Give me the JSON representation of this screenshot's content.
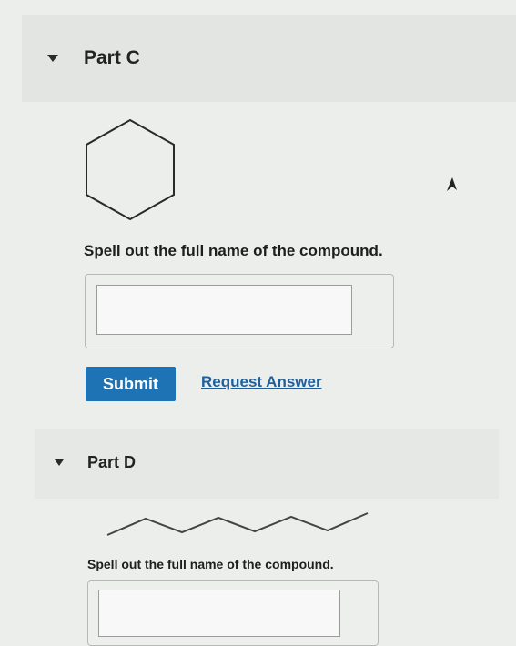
{
  "part_c": {
    "title": "Part C",
    "prompt": "Spell out the full name of the compound.",
    "answer_value": "",
    "submit_label": "Submit",
    "request_answer_label": "Request Answer",
    "structure_icon": "cyclohexane-icon"
  },
  "part_d": {
    "title": "Part D",
    "prompt": "Spell out the full name of the compound.",
    "answer_value": "",
    "structure_icon": "skeletal-chain-icon"
  },
  "colors": {
    "submit_bg": "#1d73b3",
    "link": "#1f5f9a",
    "header_bg": "#e3e5e3"
  },
  "cursor_icon": "mouse-pointer-icon"
}
